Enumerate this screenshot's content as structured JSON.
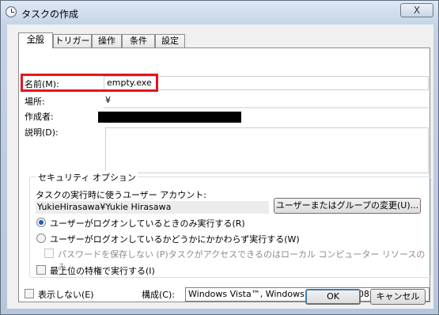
{
  "window": {
    "title": "タスクの作成",
    "close_glyph": "X"
  },
  "tabs": [
    {
      "label": "全般",
      "active": true
    },
    {
      "label": "トリガー",
      "active": false
    },
    {
      "label": "操作",
      "active": false
    },
    {
      "label": "条件",
      "active": false
    },
    {
      "label": "設定",
      "active": false
    }
  ],
  "general": {
    "name_label": "名前(M):",
    "name_value": "empty.exe",
    "location_label": "場所:",
    "location_value": "¥",
    "author_label": "作成者:",
    "description_label": "説明(D):",
    "description_value": ""
  },
  "security": {
    "legend": "セキュリティ オプション",
    "account_prompt": "タスクの実行時に使うユーザー アカウント:",
    "account_value": "YukieHirasawa¥Yukie Hirasawa",
    "change_button": "ユーザーまたはグループの変更(U)...",
    "radio_logged_on": "ユーザーがログオンしているときのみ実行する(R)",
    "radio_logged_on_checked": true,
    "radio_whether": "ユーザーがログオンしているかどうかにかかわらず実行する(W)",
    "radio_whether_checked": false,
    "no_store_password": "パスワードを保存しない (P)タスクがアクセスできるのはローカル コンピューター リソースのみ",
    "highest_privileges": "最上位の特権で実行する(I)"
  },
  "bottom": {
    "hidden_label": "表示しない(E)",
    "configure_label": "構成(C):",
    "configure_value": "Windows Vista™, Windows Server™ 2008"
  },
  "footer": {
    "ok": "OK",
    "cancel": "キャンセル"
  },
  "colors": {
    "highlight_box": "#e8141c",
    "radio_selected": "#1c5fb8"
  }
}
